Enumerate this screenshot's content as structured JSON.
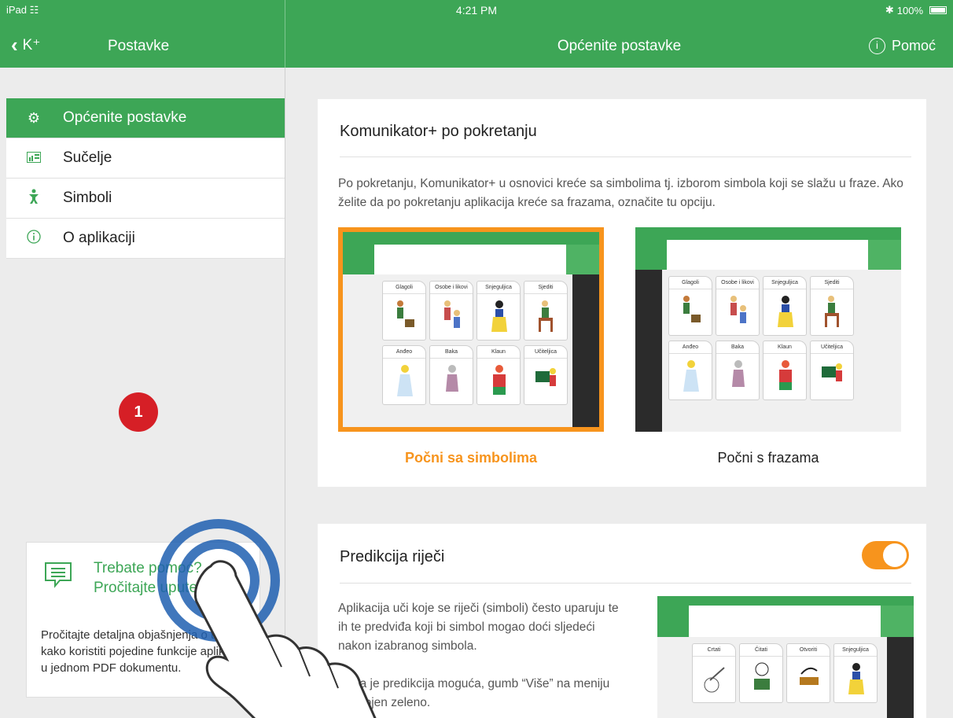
{
  "status": {
    "device": "iPad",
    "time": "4:21 PM",
    "battery": "100%"
  },
  "nav": {
    "back_label": "K⁺",
    "left_title": "Postavke",
    "main_title": "Općenite postavke",
    "help_label": "Pomoć"
  },
  "sidebar": {
    "items": [
      {
        "label": "Općenite postavke",
        "icon": "gear-icon",
        "active": true
      },
      {
        "label": "Sučelje",
        "icon": "layout-icon",
        "active": false
      },
      {
        "label": "Simboli",
        "icon": "symbol-figure-icon",
        "active": false
      },
      {
        "label": "O aplikaciji",
        "icon": "info-icon",
        "active": false
      }
    ],
    "badge": "1",
    "help_card": {
      "title_line1": "Trebate pomoć?",
      "title_line2": "Pročitajte upute",
      "text": "Pročitajte detaljna objašnjenja o tome kako koristiti pojedine funkcije aplikacije u jednom PDF dokumentu."
    }
  },
  "startup": {
    "title": "Komunikator+ po pokretanju",
    "description": "Po pokretanju, Komunikator+ u osnovici kreće sa simbolima tj. izborom simbola koji se slažu u fraze. Ako želite da po pokretanju aplikacija kreće sa frazama, označite tu opciju.",
    "option_symbols": "Počni sa simbolima",
    "option_phrases": "Počni s frazama",
    "tiles": [
      "Glagoli",
      "Osobe i likovi",
      "Snjeguljica",
      "Sjediti",
      "Anđeo",
      "Baka",
      "Klaun",
      "Učiteljica"
    ]
  },
  "prediction": {
    "title": "Predikcija riječi",
    "enabled": true,
    "description": "Aplikacija uči koje se riječi (simboli) često uparuju te ih te predviđa koji bi simbol mogao doći sljedeći nakon izabranog simbola.",
    "description2": "Kada je predikcija moguća, gumb “Više” na meniju je obojen zeleno.",
    "tiles": [
      "Crtati",
      "Čitati",
      "Otvoriti",
      "Snjeguljica"
    ]
  },
  "colors": {
    "brand_green": "#3da656",
    "accent_orange": "#f7941d",
    "badge_red": "#d61f26"
  }
}
